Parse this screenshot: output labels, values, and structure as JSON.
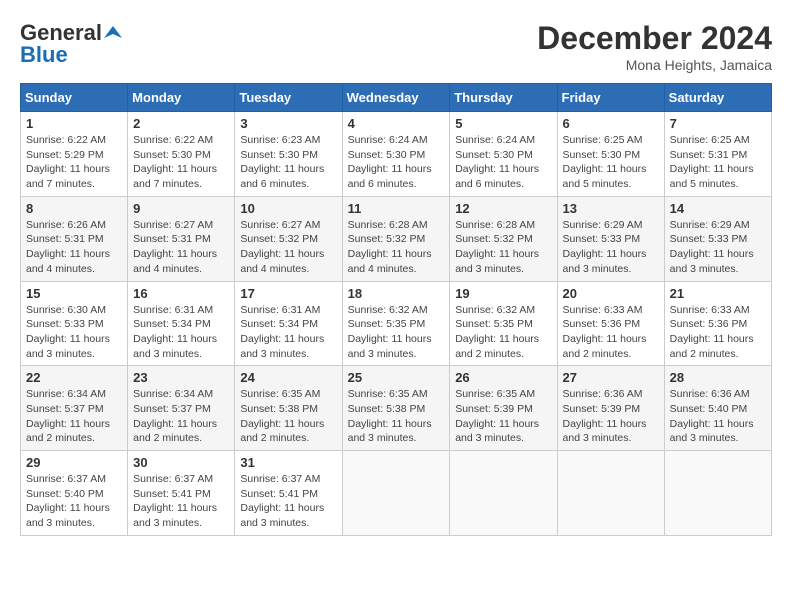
{
  "header": {
    "logo_line1": "General",
    "logo_line2": "Blue",
    "month": "December 2024",
    "location": "Mona Heights, Jamaica"
  },
  "weekdays": [
    "Sunday",
    "Monday",
    "Tuesday",
    "Wednesday",
    "Thursday",
    "Friday",
    "Saturday"
  ],
  "weeks": [
    [
      {
        "day": "1",
        "sunrise": "6:22 AM",
        "sunset": "5:29 PM",
        "daylight": "11 hours and 7 minutes."
      },
      {
        "day": "2",
        "sunrise": "6:22 AM",
        "sunset": "5:30 PM",
        "daylight": "11 hours and 7 minutes."
      },
      {
        "day": "3",
        "sunrise": "6:23 AM",
        "sunset": "5:30 PM",
        "daylight": "11 hours and 6 minutes."
      },
      {
        "day": "4",
        "sunrise": "6:24 AM",
        "sunset": "5:30 PM",
        "daylight": "11 hours and 6 minutes."
      },
      {
        "day": "5",
        "sunrise": "6:24 AM",
        "sunset": "5:30 PM",
        "daylight": "11 hours and 6 minutes."
      },
      {
        "day": "6",
        "sunrise": "6:25 AM",
        "sunset": "5:30 PM",
        "daylight": "11 hours and 5 minutes."
      },
      {
        "day": "7",
        "sunrise": "6:25 AM",
        "sunset": "5:31 PM",
        "daylight": "11 hours and 5 minutes."
      }
    ],
    [
      {
        "day": "8",
        "sunrise": "6:26 AM",
        "sunset": "5:31 PM",
        "daylight": "11 hours and 4 minutes."
      },
      {
        "day": "9",
        "sunrise": "6:27 AM",
        "sunset": "5:31 PM",
        "daylight": "11 hours and 4 minutes."
      },
      {
        "day": "10",
        "sunrise": "6:27 AM",
        "sunset": "5:32 PM",
        "daylight": "11 hours and 4 minutes."
      },
      {
        "day": "11",
        "sunrise": "6:28 AM",
        "sunset": "5:32 PM",
        "daylight": "11 hours and 4 minutes."
      },
      {
        "day": "12",
        "sunrise": "6:28 AM",
        "sunset": "5:32 PM",
        "daylight": "11 hours and 3 minutes."
      },
      {
        "day": "13",
        "sunrise": "6:29 AM",
        "sunset": "5:33 PM",
        "daylight": "11 hours and 3 minutes."
      },
      {
        "day": "14",
        "sunrise": "6:29 AM",
        "sunset": "5:33 PM",
        "daylight": "11 hours and 3 minutes."
      }
    ],
    [
      {
        "day": "15",
        "sunrise": "6:30 AM",
        "sunset": "5:33 PM",
        "daylight": "11 hours and 3 minutes."
      },
      {
        "day": "16",
        "sunrise": "6:31 AM",
        "sunset": "5:34 PM",
        "daylight": "11 hours and 3 minutes."
      },
      {
        "day": "17",
        "sunrise": "6:31 AM",
        "sunset": "5:34 PM",
        "daylight": "11 hours and 3 minutes."
      },
      {
        "day": "18",
        "sunrise": "6:32 AM",
        "sunset": "5:35 PM",
        "daylight": "11 hours and 3 minutes."
      },
      {
        "day": "19",
        "sunrise": "6:32 AM",
        "sunset": "5:35 PM",
        "daylight": "11 hours and 2 minutes."
      },
      {
        "day": "20",
        "sunrise": "6:33 AM",
        "sunset": "5:36 PM",
        "daylight": "11 hours and 2 minutes."
      },
      {
        "day": "21",
        "sunrise": "6:33 AM",
        "sunset": "5:36 PM",
        "daylight": "11 hours and 2 minutes."
      }
    ],
    [
      {
        "day": "22",
        "sunrise": "6:34 AM",
        "sunset": "5:37 PM",
        "daylight": "11 hours and 2 minutes."
      },
      {
        "day": "23",
        "sunrise": "6:34 AM",
        "sunset": "5:37 PM",
        "daylight": "11 hours and 2 minutes."
      },
      {
        "day": "24",
        "sunrise": "6:35 AM",
        "sunset": "5:38 PM",
        "daylight": "11 hours and 2 minutes."
      },
      {
        "day": "25",
        "sunrise": "6:35 AM",
        "sunset": "5:38 PM",
        "daylight": "11 hours and 3 minutes."
      },
      {
        "day": "26",
        "sunrise": "6:35 AM",
        "sunset": "5:39 PM",
        "daylight": "11 hours and 3 minutes."
      },
      {
        "day": "27",
        "sunrise": "6:36 AM",
        "sunset": "5:39 PM",
        "daylight": "11 hours and 3 minutes."
      },
      {
        "day": "28",
        "sunrise": "6:36 AM",
        "sunset": "5:40 PM",
        "daylight": "11 hours and 3 minutes."
      }
    ],
    [
      {
        "day": "29",
        "sunrise": "6:37 AM",
        "sunset": "5:40 PM",
        "daylight": "11 hours and 3 minutes."
      },
      {
        "day": "30",
        "sunrise": "6:37 AM",
        "sunset": "5:41 PM",
        "daylight": "11 hours and 3 minutes."
      },
      {
        "day": "31",
        "sunrise": "6:37 AM",
        "sunset": "5:41 PM",
        "daylight": "11 hours and 3 minutes."
      },
      null,
      null,
      null,
      null
    ]
  ],
  "labels": {
    "sunrise": "Sunrise: ",
    "sunset": "Sunset: ",
    "daylight": "Daylight: "
  }
}
